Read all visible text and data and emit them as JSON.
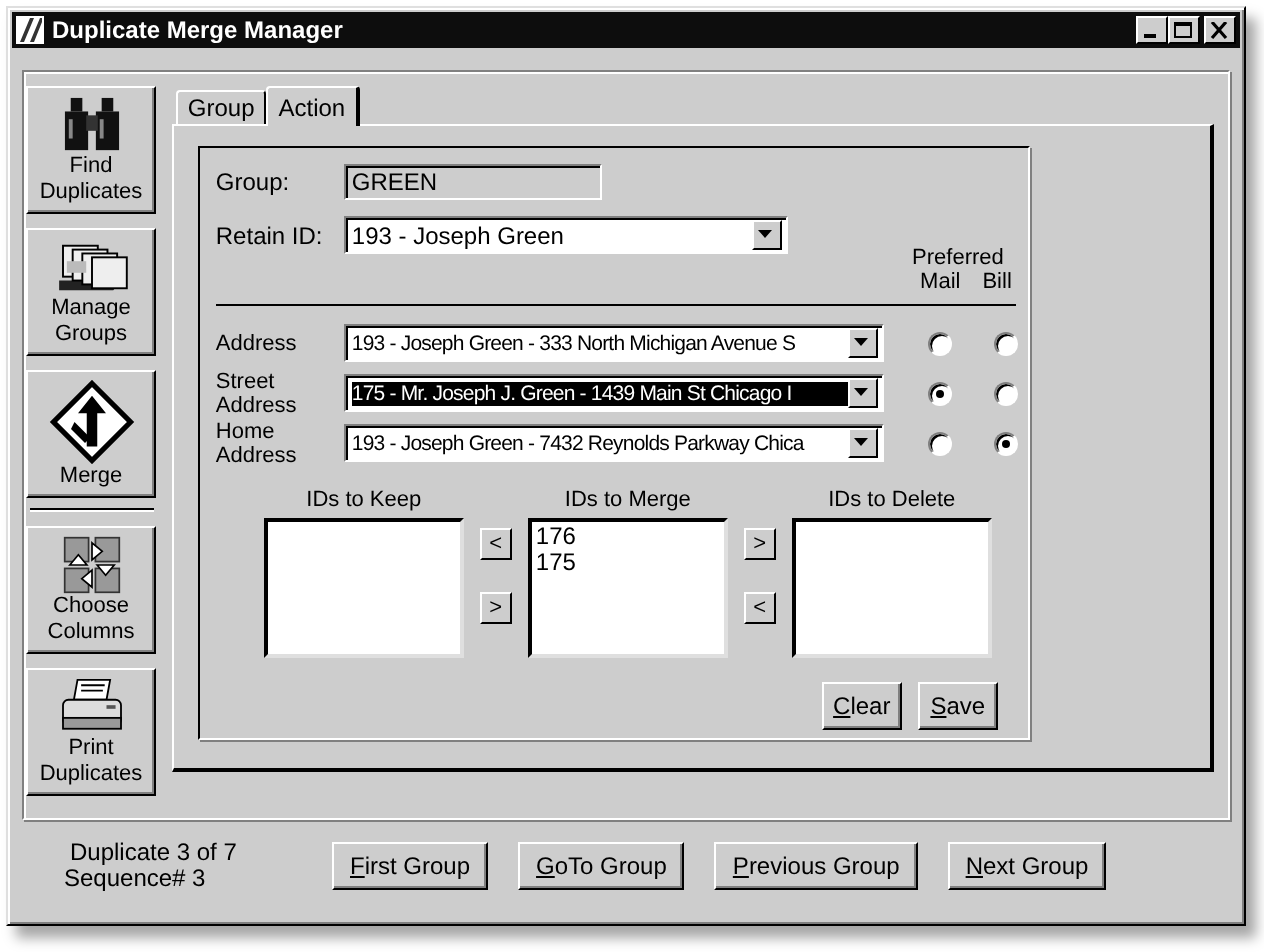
{
  "window": {
    "title": "Duplicate Merge Manager"
  },
  "toolbar": [
    {
      "label": "Find Duplicates"
    },
    {
      "label": "Manage Groups"
    },
    {
      "label": "Merge"
    },
    {
      "label": "Choose Columns"
    },
    {
      "label": "Print Duplicates"
    }
  ],
  "tabs": [
    {
      "label": "Group",
      "selected": false
    },
    {
      "label": "Action",
      "selected": true
    }
  ],
  "group": {
    "label": "Group:",
    "value": "GREEN"
  },
  "retain": {
    "label": "Retain ID:",
    "value": "193 - Joseph Green"
  },
  "preferred": {
    "title": "Preferred",
    "columns": [
      "Mail",
      "Bill"
    ]
  },
  "addresses": [
    {
      "label": "Address",
      "value": "193 - Joseph Green - 333 North Michigan Avenue S",
      "highlighted": false,
      "mail": false,
      "bill": false
    },
    {
      "label": "Street Address",
      "value": "175 - Mr. Joseph J. Green - 1439 Main St  Chicago I",
      "highlighted": true,
      "mail": true,
      "bill": false
    },
    {
      "label": "Home Address",
      "value": "193 - Joseph Green - 7432 Reynolds Parkway  Chica",
      "highlighted": false,
      "mail": false,
      "bill": true
    }
  ],
  "lists": [
    {
      "title": "IDs to Keep"
    },
    {
      "title": "IDs to Merge",
      "items": [
        "176",
        "175"
      ]
    },
    {
      "title": "IDs to Delete"
    }
  ],
  "move_buttons": [
    [
      "<",
      ">"
    ],
    [
      ">",
      "<"
    ]
  ],
  "actions": [
    "Clear",
    "Save"
  ],
  "status": [
    "Duplicate 3 of 7",
    "Sequence# 3"
  ],
  "nav": [
    "First Group",
    "GoTo Group",
    "Previous Group",
    "Next Group"
  ]
}
